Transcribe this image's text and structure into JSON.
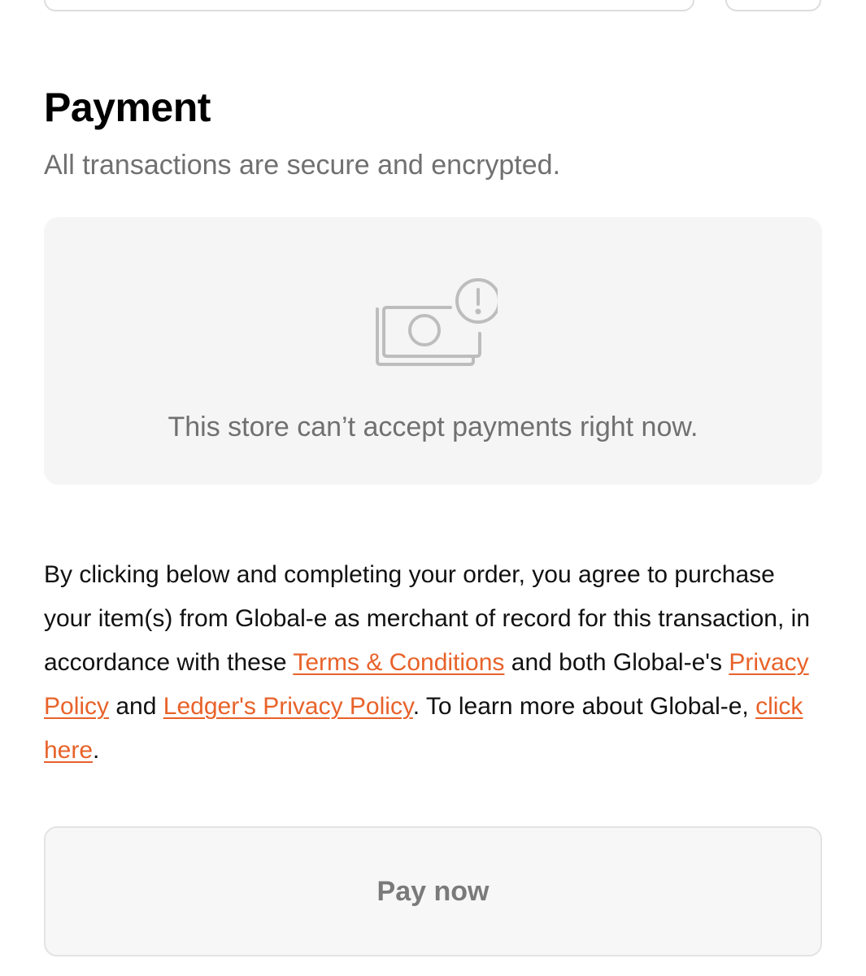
{
  "payment": {
    "title": "Payment",
    "subtitle": "All transactions are secure and encrypted."
  },
  "notice": {
    "icon": "cash-alert-icon",
    "message": "This store can’t accept payments right now."
  },
  "legal": {
    "text_1": "By clicking below and completing your order, you agree to purchase your item(s) from Global-e as merchant of record for this transaction, in accordance with these ",
    "terms_link": "Terms & Conditions",
    "text_2": " and both Global-e's ",
    "privacy_link": "Privacy Policy",
    "text_3": " and ",
    "ledger_privacy_link": "Ledger's Privacy Policy",
    "text_4": ". To learn more about Global-e, ",
    "click_here_link": "click here",
    "text_5": "."
  },
  "pay_button": {
    "label": "Pay now"
  },
  "colors": {
    "link": "#e8622a",
    "muted_text": "#707070",
    "panel_bg": "#f5f5f5"
  }
}
